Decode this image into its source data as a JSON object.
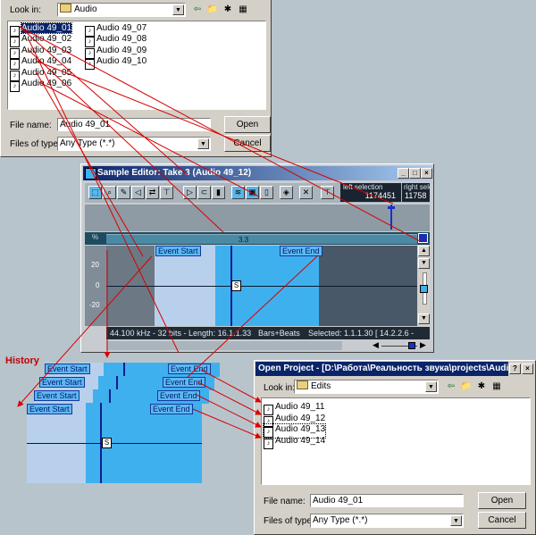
{
  "dialog1": {
    "look_in_label": "Look in:",
    "look_in_value": "Audio",
    "files_col1": [
      "Audio 49_01",
      "Audio 49_02",
      "Audio 49_03",
      "Audio 49_04",
      "Audio 49_05",
      "Audio 49_06"
    ],
    "files_col2": [
      "Audio 49_07",
      "Audio 49_08",
      "Audio 49_09",
      "Audio 49_10"
    ],
    "file_name_label": "File name:",
    "file_name_value": "Audio 49_01",
    "files_type_label": "Files of type:",
    "files_type_value": "Any Type (*.*)",
    "open_label": "Open",
    "cancel_label": "Cancel"
  },
  "editor": {
    "title": "Sample Editor: Take 3 (Audio 49_12)",
    "left_selection_label": "left selection",
    "left_selection_value": "1174451",
    "right_selection_label": "right select",
    "right_selection_value": "11758",
    "ruler_marker": "3.3",
    "percent_label": "%",
    "scale_labels": [
      "20",
      "0",
      "-20"
    ],
    "event_start": "Event Start",
    "event_end": "Event End",
    "s_marker": "S",
    "status_info": "44.100 kHz - 32 bits - Length:  16.1.1.33",
    "status_mode": "Bars+Beats",
    "status_selected": "Selected:   1.1.1.30 [   14.2.2.6 -"
  },
  "history": {
    "label": "History",
    "event_start": "Event Start",
    "event_end": "Event End",
    "s_marker": "S"
  },
  "dialog2": {
    "title": "Open Project - [D:\\Работа\\Реальность звука\\projects\\Audio\\A...",
    "help_btn": "?",
    "close_btn": "×",
    "look_in_label": "Look in:",
    "look_in_value": "Edits",
    "files": [
      "Audio 49_11",
      "Audio 49_12",
      "Audio 49_13",
      "Audio 49_14"
    ],
    "file_name_label": "File name:",
    "file_name_value": "Audio 49_01",
    "files_type_label": "Files of type:",
    "files_type_value": "Any Type (*.*)",
    "open_label": "Open",
    "cancel_label": "Cancel"
  },
  "colors": {
    "waveform_bg": "#485868",
    "event_light": "#b8d0ec",
    "event_blue": "#3fb0ee",
    "playhead": "#102090",
    "arrow": "#d80000"
  }
}
